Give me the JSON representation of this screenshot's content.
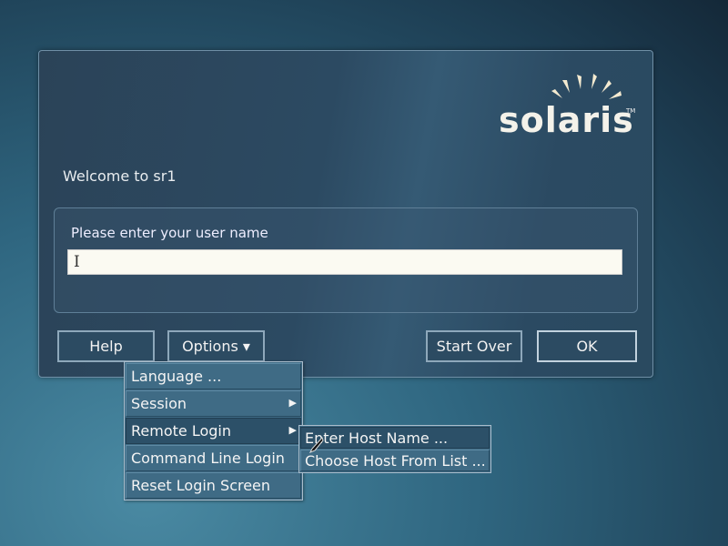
{
  "logo": {
    "text": "solaris",
    "tm": "TM"
  },
  "welcome": "Welcome to sr1",
  "prompt": "Please enter your user name",
  "username_value": "",
  "buttons": {
    "help": "Help",
    "options": "Options ▾",
    "start_over": "Start Over",
    "ok": "OK"
  },
  "options_menu": [
    "Language ...",
    "Session",
    "Remote Login",
    "Command Line Login",
    "Reset Login Screen"
  ],
  "remote_login_submenu": [
    "Enter Host Name ...",
    "Choose Host From List ..."
  ],
  "submenu_arrow": "▶"
}
